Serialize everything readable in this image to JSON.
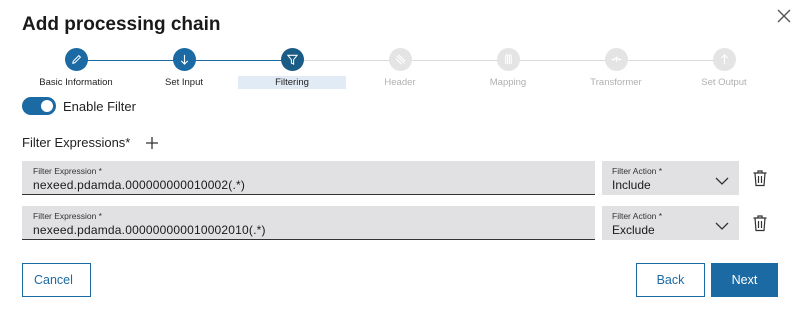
{
  "dialog": {
    "title": "Add processing chain"
  },
  "stepper": {
    "steps": [
      {
        "label": "Basic Information",
        "state": "done",
        "icon": "pencil-icon"
      },
      {
        "label": "Set Input",
        "state": "done",
        "icon": "arrow-down-icon"
      },
      {
        "label": "Filtering",
        "state": "active",
        "icon": "filter-icon"
      },
      {
        "label": "Header",
        "state": "todo",
        "icon": "header-icon"
      },
      {
        "label": "Mapping",
        "state": "todo",
        "icon": "mapping-icon"
      },
      {
        "label": "Transformer",
        "state": "todo",
        "icon": "transformer-icon"
      },
      {
        "label": "Set Output",
        "state": "todo",
        "icon": "arrow-up-icon"
      }
    ]
  },
  "filter_toggle": {
    "label": "Enable Filter",
    "enabled": true
  },
  "filter_expressions": {
    "label": "Filter Expressions*",
    "rows": [
      {
        "expression_label": "Filter Expression *",
        "expression_value": "nexeed.pdamda.000000000010002(.*)",
        "action_label": "Filter Action *",
        "action_value": "Include"
      },
      {
        "expression_label": "Filter Expression *",
        "expression_value": "nexeed.pdamda.000000000010002010(.*)",
        "action_label": "Filter Action *",
        "action_value": "Exclude"
      }
    ]
  },
  "footer": {
    "cancel_label": "Cancel",
    "back_label": "Back",
    "next_label": "Next"
  },
  "colors": {
    "primary": "#1b6aa3",
    "active_step": "#1b5c86",
    "field_bg": "#e1e1e4",
    "inactive_step": "#e4e4e4"
  }
}
